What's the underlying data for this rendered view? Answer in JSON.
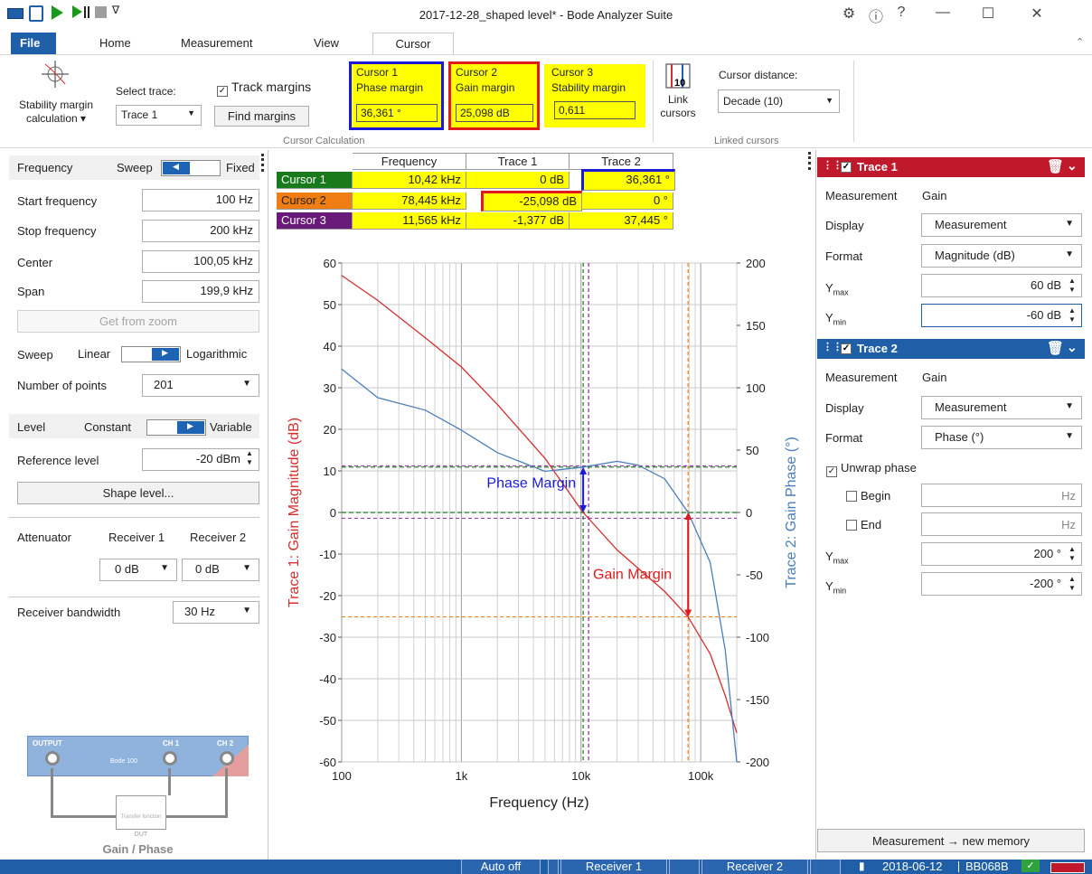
{
  "window": {
    "title": "2017-12-28_shaped level* - Bode Analyzer Suite"
  },
  "ribbon_tabs": [
    "File",
    "Home",
    "Measurement",
    "View",
    "Cursor"
  ],
  "ribbon": {
    "stability_btn": "Stability margin",
    "stability_btn2": "calculation ▾",
    "select_trace_label": "Select trace:",
    "select_trace_value": "Trace 1",
    "track_margins": "Track margins",
    "find_margins": "Find margins",
    "cursor1": {
      "title": "Cursor 1",
      "sub": "Phase margin",
      "value": "36,361 °"
    },
    "cursor2": {
      "title": "Cursor 2",
      "sub": "Gain margin",
      "value": "25,098 dB"
    },
    "cursor3": {
      "title": "Cursor 3",
      "sub": "Stability margin",
      "value": "0,611"
    },
    "group_cursor_calc": "Cursor Calculation",
    "link_cursors": "Link",
    "link_cursors2": "cursors",
    "cursor_distance_label": "Cursor distance:",
    "cursor_distance_value": "Decade (10)",
    "group_linked": "Linked cursors"
  },
  "left_panel": {
    "frequency_label": "Frequency",
    "sweep": "Sweep",
    "fixed": "Fixed",
    "start_frequency_label": "Start frequency",
    "start_frequency": "100 Hz",
    "stop_frequency_label": "Stop frequency",
    "stop_frequency": "200 kHz",
    "center_label": "Center",
    "center": "100,05 kHz",
    "span_label": "Span",
    "span": "199,9 kHz",
    "get_from_zoom": "Get from zoom",
    "sweep_label": "Sweep",
    "linear": "Linear",
    "logarithmic": "Logarithmic",
    "points_label": "Number of points",
    "points": "201",
    "level_label": "Level",
    "constant": "Constant",
    "variable": "Variable",
    "reference_level_label": "Reference level",
    "reference_level": "-20 dBm",
    "shape_level": "Shape level...",
    "attenuator_label": "Attenuator",
    "receiver1": "Receiver 1",
    "receiver2": "Receiver 2",
    "att_r1": "0 dB",
    "att_r2": "0 dB",
    "rbw_label": "Receiver bandwidth",
    "rbw": "30 Hz",
    "diagram": {
      "output": "OUTPUT",
      "ch1": "CH 1",
      "ch2": "CH 2",
      "device": "Bode 100",
      "tf": "Transfer function",
      "dut": "DUT",
      "caption": "Gain / Phase"
    }
  },
  "cursor_table": {
    "headers": [
      "Frequency",
      "Trace 1",
      "Trace 2"
    ],
    "rows": [
      {
        "name": "Cursor 1",
        "freq": "10,42 kHz",
        "t1": "0 dB",
        "t2": "36,361 °"
      },
      {
        "name": "Cursor 2",
        "freq": "78,445 kHz",
        "t1": "-25,098 dB",
        "t2": "0 °"
      },
      {
        "name": "Cursor 3",
        "freq": "11,565 kHz",
        "t1": "-1,377 dB",
        "t2": "37,445 °"
      }
    ]
  },
  "chart_data": {
    "type": "line",
    "xlabel": "Frequency (Hz)",
    "ylabel": "Trace 1: Gain Magnitude (dB)",
    "ylabel2": "Trace 2: Gain Phase (°)",
    "x_scale": "log",
    "xlim": [
      100,
      200000
    ],
    "ylim": [
      -60,
      60
    ],
    "y2lim": [
      -200,
      200
    ],
    "xticks": [
      "100",
      "1k",
      "10k",
      "100k"
    ],
    "yticks": [
      "60",
      "50",
      "40",
      "30",
      "20",
      "10",
      "0",
      "-10",
      "-20",
      "-30",
      "-40",
      "-50",
      "-60"
    ],
    "y2ticks": [
      "200",
      "150",
      "100",
      "50",
      "0",
      "-50",
      "-100",
      "-150",
      "-200"
    ],
    "grid": true,
    "series": [
      {
        "name": "Trace 1",
        "axis": "left",
        "color": "#d32f2f",
        "x": [
          100,
          200,
          500,
          1000,
          2000,
          5000,
          10420,
          20000,
          50000,
          78445,
          120000,
          160000,
          200000
        ],
        "y": [
          57,
          51,
          42,
          35,
          26,
          13,
          0,
          -9,
          -19,
          -25.1,
          -34,
          -44,
          -53
        ]
      },
      {
        "name": "Trace 2",
        "axis": "right",
        "color": "#4a7ebb",
        "x": [
          100,
          200,
          500,
          1000,
          2000,
          5000,
          10420,
          20000,
          30000,
          50000,
          78445,
          120000,
          160000,
          200000
        ],
        "y": [
          115,
          92,
          82,
          66,
          48,
          33,
          36.4,
          41,
          38,
          27,
          0,
          -40,
          -110,
          -200
        ]
      }
    ],
    "annotations": [
      {
        "text": "Phase Margin",
        "color": "#1a1ad6"
      },
      {
        "text": "Gain Margin",
        "color": "#e01b1b"
      }
    ]
  },
  "right_panel": {
    "trace1": {
      "title": "Trace 1",
      "measurement_label": "Measurement",
      "measurement": "Gain",
      "display_label": "Display",
      "display": "Measurement",
      "format_label": "Format",
      "format": "Magnitude (dB)",
      "ymax_label": "Y",
      "ymax_sub": "max",
      "ymax": "60 dB",
      "ymin_label": "Y",
      "ymin_sub": "min",
      "ymin": "-60 dB",
      "color": "#c0192b"
    },
    "trace2": {
      "title": "Trace 2",
      "measurement_label": "Measurement",
      "measurement": "Gain",
      "display_label": "Display",
      "display": "Measurement",
      "format_label": "Format",
      "format": "Phase (°)",
      "unwrap": "Unwrap phase",
      "begin": "Begin",
      "end": "End",
      "hz1": "Hz",
      "hz2": "Hz",
      "ymax_label": "Y",
      "ymax_sub": "max",
      "ymax": "200 °",
      "ymin_label": "Y",
      "ymin_sub": "min",
      "ymin": "-200 °",
      "color": "#1f5fa8"
    },
    "new_memory": "Measurement → new memory"
  },
  "status": {
    "auto": "Auto off",
    "receiver1": "Receiver 1",
    "receiver2": "Receiver 2",
    "date": "2018-06-12",
    "device": "BB068B"
  }
}
